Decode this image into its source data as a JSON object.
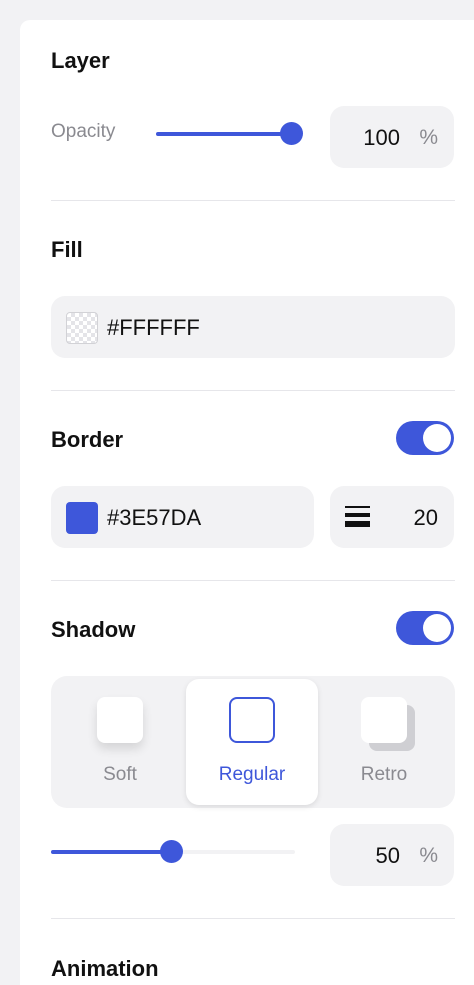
{
  "layer": {
    "title": "Layer",
    "opacity_label": "Opacity",
    "opacity_value": "100",
    "opacity_unit": "%",
    "opacity_fraction": 1.0
  },
  "fill": {
    "title": "Fill",
    "color_hex": "#FFFFFF"
  },
  "border": {
    "title": "Border",
    "enabled": true,
    "color_hex": "#3E57DA",
    "width_value": "20"
  },
  "shadow": {
    "title": "Shadow",
    "enabled": true,
    "options": [
      {
        "label": "Soft",
        "selected": false
      },
      {
        "label": "Regular",
        "selected": true
      },
      {
        "label": "Retro",
        "selected": false
      }
    ],
    "intensity_value": "50",
    "intensity_unit": "%",
    "intensity_fraction": 0.5
  },
  "animation": {
    "title": "Animation"
  },
  "colors": {
    "accent": "#3E57DA",
    "muted_text": "#8a8a90",
    "field_bg": "#f2f2f4"
  }
}
